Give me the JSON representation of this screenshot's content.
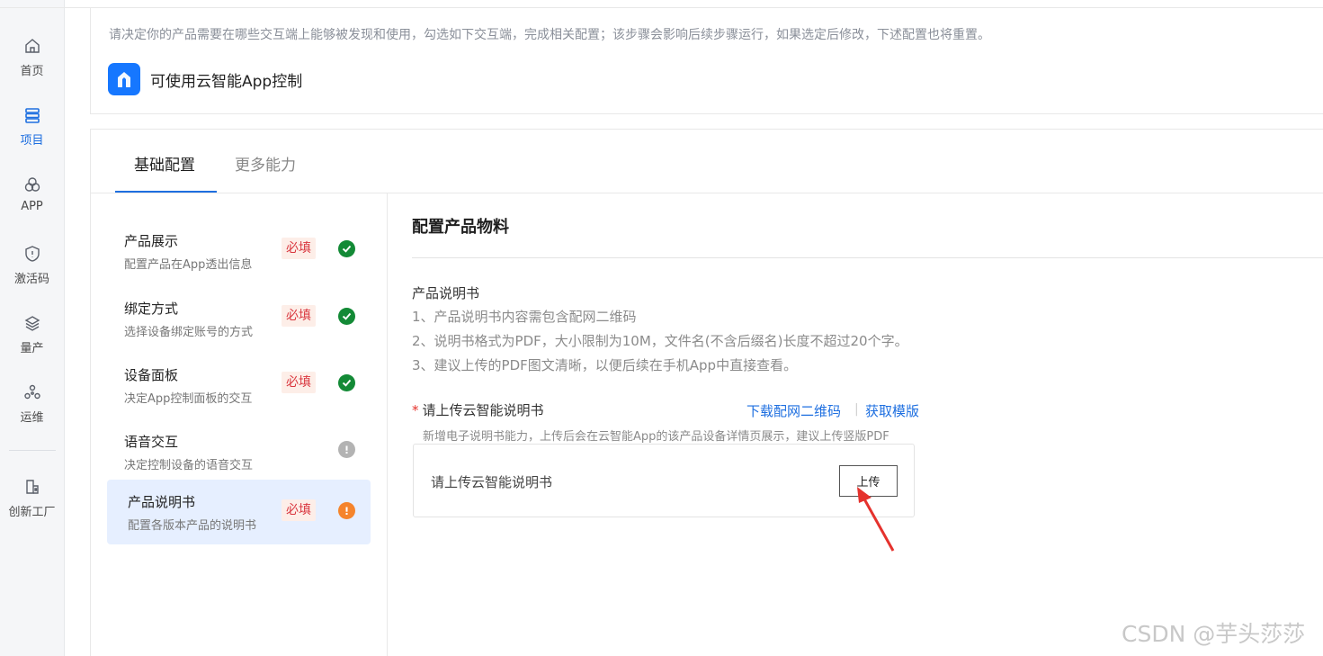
{
  "nav": {
    "items": [
      {
        "label": "首页",
        "icon": "home-icon"
      },
      {
        "label": "项目",
        "icon": "list-icon",
        "active": true
      },
      {
        "label": "APP",
        "icon": "app-circles-icon"
      },
      {
        "label": "激活码",
        "icon": "shield-icon"
      },
      {
        "label": "量产",
        "icon": "layers-icon"
      },
      {
        "label": "运维",
        "icon": "nodes-icon"
      },
      {
        "label": "创新工厂",
        "icon": "factory-doc-icon"
      }
    ]
  },
  "top": {
    "description": "请决定你的产品需要在哪些交互端上能够被发现和使用，勾选如下交互端，完成相关配置；该步骤会影响后续步骤运行，如果选定后修改，下述配置也将重置。",
    "app_option": "可使用云智能App控制"
  },
  "tabs": [
    "基础配置",
    "更多能力"
  ],
  "steps": [
    {
      "title": "产品展示",
      "subtitle": "配置产品在App透出信息",
      "required": "必填",
      "status": "done"
    },
    {
      "title": "绑定方式",
      "subtitle": "选择设备绑定账号的方式",
      "required": "必填",
      "status": "done"
    },
    {
      "title": "设备面板",
      "subtitle": "决定App控制面板的交互",
      "required": "必填",
      "status": "done"
    },
    {
      "title": "语音交互",
      "subtitle": "决定控制设备的语音交互",
      "required": "",
      "status": "optional"
    },
    {
      "title": "产品说明书",
      "subtitle": "配置各版本产品的说明书",
      "required": "必填",
      "status": "warning"
    }
  ],
  "content": {
    "section_title": "配置产品物料",
    "material_name": "产品说明书",
    "rules": [
      "1、产品说明书内容需包含配网二维码",
      "2、说明书格式为PDF，大小限制为10M，文件名(不含后缀名)长度不超过20个字。",
      "3、建议上传的PDF图文清晰，以便后续在手机App中直接查看。"
    ],
    "field_star": "*",
    "field_label": "请上传云智能说明书",
    "links": [
      "下载配网二维码",
      "获取模版"
    ],
    "link_separator": "|",
    "hint": "新增电子说明书能力，上传后会在云智能App的该产品设备详情页展示，建议上传竖版PDF",
    "upload_placeholder": "请上传云智能说明书",
    "upload_button": "上传"
  },
  "watermark": "CSDN @芋头莎莎",
  "colors": {
    "primary": "#1e6fe0",
    "required_text": "#d9363e",
    "success": "#138a36",
    "warning": "#f5842c",
    "active_step_bg": "#e6efff",
    "annotation_arrow": "#e5322d"
  }
}
